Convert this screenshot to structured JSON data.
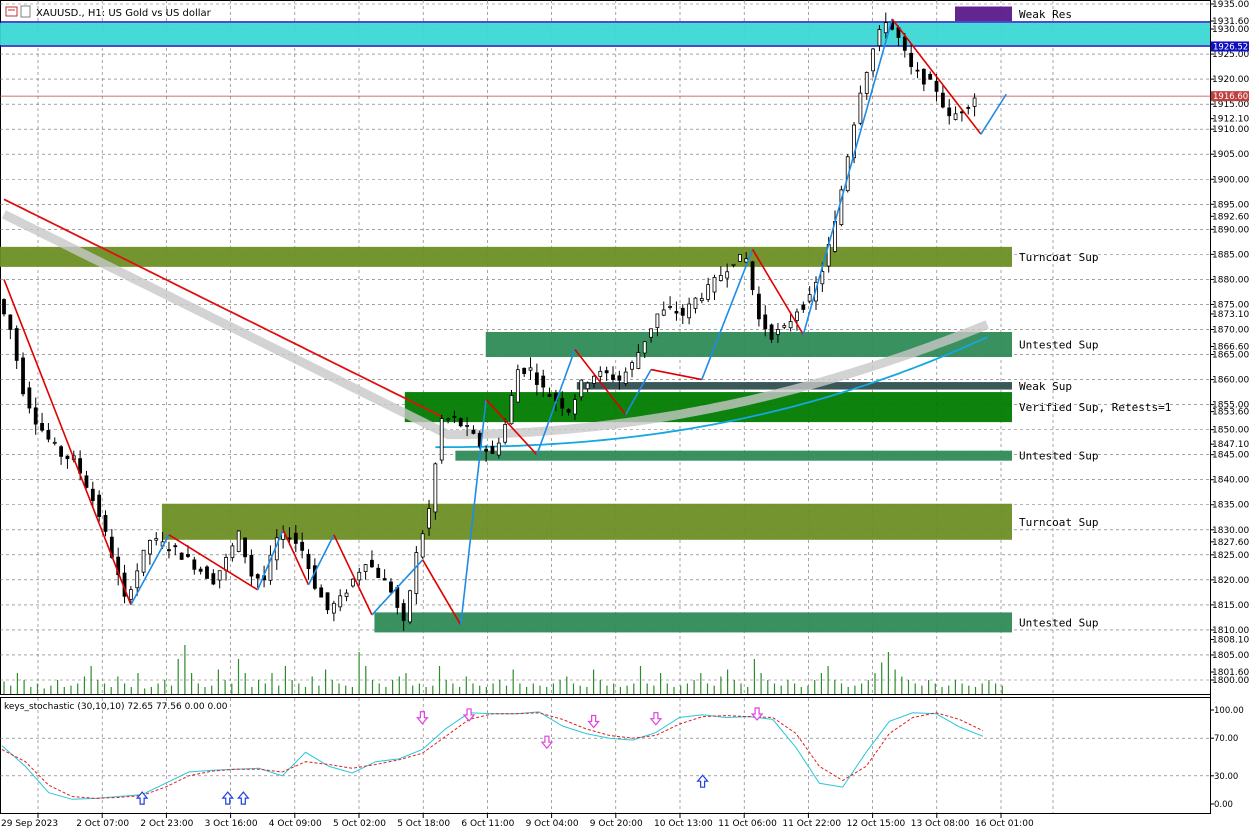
{
  "header": {
    "symbol_title": "XAUUSD., H1:  US Gold vs US dollar"
  },
  "indicator": {
    "title": "keys_stochastic (30,10,10) 72.65 77.56 0.00 0.00"
  },
  "colors": {
    "background": "#ffffff",
    "grid": "#6b6b6b",
    "bull_candle": "#000000",
    "bear_candle": "#000000",
    "zigzag_down": "#e00000",
    "zigzag_up": "#1e8be6",
    "ma_red": "#e01010",
    "ma_band": "#c8c8c8",
    "ma_cyan": "#14a7e0",
    "zone_cyan": "#3cd8d4",
    "zone_olive": "#6b8e23",
    "zone_green": "#2e8b57",
    "zone_dark_green": "#007b00",
    "zone_purple": "#5a1a8a",
    "zone_slate": "#2f4f4f",
    "volume": "#2e8b2e",
    "stoch_main": "#28c8d8",
    "stoch_signal": "#e02020",
    "arrow_down": "#e040e0",
    "arrow_up": "#2040e0",
    "price_line": "#c04040"
  },
  "chart_data": {
    "type": "candlestick",
    "x_tick_labels": [
      "29 Sep 2023",
      "2 Oct 07:00",
      "2 Oct 23:00",
      "3 Oct 16:00",
      "4 Oct 09:00",
      "5 Oct 02:00",
      "5 Oct 18:00",
      "6 Oct 11:00",
      "9 Oct 04:00",
      "9 Oct 20:00",
      "10 Oct 13:00",
      "11 Oct 06:00",
      "11 Oct 22:00",
      "12 Oct 15:00",
      "13 Oct 08:00",
      "16 Oct 01:00"
    ],
    "y_tick_labels": [
      "1935.00",
      "1931.60",
      "1930.00",
      "1925.00",
      "1920.00",
      "1915.00",
      "1912.10",
      "1910.00",
      "1905.00",
      "1900.00",
      "1895.00",
      "1892.60",
      "1890.00",
      "1885.00",
      "1880.00",
      "1875.00",
      "1873.10",
      "1870.00",
      "1866.60",
      "1865.00",
      "1860.00",
      "1855.00",
      "1853.60",
      "1850.00",
      "1847.10",
      "1845.00",
      "1840.00",
      "1835.00",
      "1830.00",
      "1827.60",
      "1825.00",
      "1820.00",
      "1815.00",
      "1810.00",
      "1808.10",
      "1805.00",
      "1801.60",
      "1800.00"
    ],
    "ylim": [
      1800,
      1935
    ],
    "current_price_label": "1916.60",
    "highlight_price_label": "1926.52",
    "close_path": [
      [
        0,
        1876
      ],
      [
        2,
        1870
      ],
      [
        4,
        1858
      ],
      [
        6,
        1852
      ],
      [
        8,
        1848
      ],
      [
        10,
        1845
      ],
      [
        12,
        1844
      ],
      [
        14,
        1839
      ],
      [
        16,
        1833
      ],
      [
        18,
        1825
      ],
      [
        20,
        1816
      ],
      [
        22,
        1822
      ],
      [
        24,
        1828
      ],
      [
        26,
        1827
      ],
      [
        28,
        1826
      ],
      [
        30,
        1824
      ],
      [
        32,
        1822
      ],
      [
        34,
        1820
      ],
      [
        36,
        1824
      ],
      [
        38,
        1829
      ],
      [
        40,
        1821
      ],
      [
        42,
        1820
      ],
      [
        44,
        1828
      ],
      [
        46,
        1829
      ],
      [
        48,
        1826
      ],
      [
        50,
        1819
      ],
      [
        52,
        1814
      ],
      [
        54,
        1816
      ],
      [
        56,
        1820
      ],
      [
        58,
        1824
      ],
      [
        60,
        1821
      ],
      [
        62,
        1818
      ],
      [
        64,
        1811
      ],
      [
        66,
        1825
      ],
      [
        68,
        1834
      ],
      [
        70,
        1852
      ],
      [
        72,
        1852
      ],
      [
        74,
        1850
      ],
      [
        76,
        1847
      ],
      [
        78,
        1845
      ],
      [
        80,
        1851
      ],
      [
        82,
        1862
      ],
      [
        84,
        1862
      ],
      [
        86,
        1858
      ],
      [
        88,
        1856
      ],
      [
        90,
        1854
      ],
      [
        92,
        1859
      ],
      [
        94,
        1861
      ],
      [
        96,
        1861
      ],
      [
        98,
        1860
      ],
      [
        100,
        1863
      ],
      [
        102,
        1868
      ],
      [
        104,
        1873
      ],
      [
        106,
        1874
      ],
      [
        108,
        1873
      ],
      [
        110,
        1876
      ],
      [
        112,
        1878
      ],
      [
        114,
        1881
      ],
      [
        116,
        1884
      ],
      [
        118,
        1884
      ],
      [
        120,
        1872
      ],
      [
        122,
        1869
      ],
      [
        124,
        1870
      ],
      [
        126,
        1874
      ],
      [
        128,
        1876
      ],
      [
        130,
        1882
      ],
      [
        132,
        1891
      ],
      [
        134,
        1905
      ],
      [
        136,
        1918
      ],
      [
        138,
        1926
      ],
      [
        140,
        1932
      ],
      [
        142,
        1928
      ],
      [
        144,
        1922
      ],
      [
        146,
        1920
      ],
      [
        148,
        1918
      ],
      [
        150,
        1912
      ],
      [
        152,
        1914
      ],
      [
        154,
        1916.6
      ]
    ],
    "volume_heights": [
      0.18,
      0.12,
      0.3,
      0.2,
      0.1,
      0.15,
      0.08,
      0.12,
      0.2,
      0.1,
      0.12,
      0.15,
      0.25,
      0.4,
      0.2,
      0.15,
      0.1,
      0.25,
      0.15,
      0.1,
      0.3,
      0.08,
      0.1,
      0.15,
      0.2,
      0.12,
      0.5,
      0.7,
      0.3,
      0.15,
      0.1,
      0.12,
      0.35,
      0.2,
      0.15,
      0.5,
      0.3,
      0.1,
      0.2,
      0.15,
      0.3,
      0.12,
      0.4,
      0.2,
      0.15,
      0.1,
      0.25,
      0.12,
      0.35,
      0.2,
      0.15,
      0.12,
      0.1,
      0.6,
      0.4,
      0.2,
      0.15,
      0.1,
      0.2,
      0.25,
      0.3,
      0.12,
      0.15,
      0.1,
      0.12,
      0.4,
      0.2,
      0.15,
      0.1,
      0.25,
      0.15,
      0.12,
      0.1,
      0.15,
      0.2,
      0.12,
      0.35,
      0.15,
      0.1,
      0.15,
      0.12,
      0.1,
      0.15,
      0.2,
      0.25,
      0.15,
      0.12,
      0.1,
      0.35,
      0.2,
      0.12,
      0.15,
      0.1,
      0.12,
      0.15,
      0.4,
      0.15,
      0.12,
      0.3,
      0.15,
      0.1,
      0.12,
      0.15,
      0.2,
      0.3,
      0.15,
      0.12,
      0.25,
      0.35,
      0.2,
      0.15,
      0.1,
      0.5,
      0.3,
      0.2,
      0.15,
      0.12,
      0.2,
      0.15,
      0.1,
      0.12,
      0.2,
      0.3,
      0.4,
      0.2,
      0.15,
      0.1,
      0.12,
      0.15,
      0.2,
      0.3,
      0.45,
      0.6,
      0.35,
      0.25,
      0.2,
      0.15,
      0.12,
      0.2,
      0.15,
      0.1,
      0.12,
      0.2,
      0.15,
      0.12,
      0.1,
      0.15,
      0.2,
      0.15,
      0.12
    ],
    "stoch_ylim": [
      0,
      100
    ],
    "stoch_tick_labels": [
      "100.00",
      "70.00",
      "30.00",
      "0.00"
    ],
    "stoch_main": [
      [
        0,
        62
      ],
      [
        6,
        40
      ],
      [
        12,
        12
      ],
      [
        18,
        5
      ],
      [
        24,
        6
      ],
      [
        30,
        8
      ],
      [
        36,
        10
      ],
      [
        42,
        22
      ],
      [
        48,
        34
      ],
      [
        54,
        36
      ],
      [
        60,
        37
      ],
      [
        66,
        38
      ],
      [
        72,
        30
      ],
      [
        78,
        55
      ],
      [
        84,
        40
      ],
      [
        90,
        33
      ],
      [
        96,
        45
      ],
      [
        102,
        48
      ],
      [
        108,
        58
      ],
      [
        114,
        80
      ],
      [
        120,
        97
      ],
      [
        126,
        96
      ],
      [
        132,
        96
      ],
      [
        138,
        98
      ],
      [
        144,
        83
      ],
      [
        150,
        75
      ],
      [
        156,
        70
      ],
      [
        162,
        68
      ],
      [
        168,
        76
      ],
      [
        174,
        92
      ],
      [
        180,
        95
      ],
      [
        186,
        92
      ],
      [
        192,
        93
      ],
      [
        198,
        90
      ],
      [
        204,
        60
      ],
      [
        210,
        22
      ],
      [
        216,
        18
      ],
      [
        222,
        55
      ],
      [
        228,
        88
      ],
      [
        234,
        97
      ],
      [
        240,
        96
      ],
      [
        246,
        82
      ],
      [
        252,
        72
      ]
    ],
    "stoch_signal": [
      [
        0,
        58
      ],
      [
        6,
        45
      ],
      [
        12,
        20
      ],
      [
        18,
        8
      ],
      [
        24,
        6
      ],
      [
        30,
        7
      ],
      [
        36,
        9
      ],
      [
        42,
        18
      ],
      [
        48,
        30
      ],
      [
        54,
        35
      ],
      [
        60,
        37
      ],
      [
        66,
        37
      ],
      [
        72,
        34
      ],
      [
        78,
        45
      ],
      [
        84,
        42
      ],
      [
        90,
        38
      ],
      [
        96,
        42
      ],
      [
        102,
        47
      ],
      [
        108,
        54
      ],
      [
        114,
        72
      ],
      [
        120,
        90
      ],
      [
        126,
        96
      ],
      [
        132,
        96
      ],
      [
        138,
        97
      ],
      [
        144,
        90
      ],
      [
        150,
        80
      ],
      [
        156,
        73
      ],
      [
        162,
        70
      ],
      [
        168,
        73
      ],
      [
        174,
        85
      ],
      [
        180,
        93
      ],
      [
        186,
        94
      ],
      [
        192,
        93
      ],
      [
        198,
        92
      ],
      [
        204,
        75
      ],
      [
        210,
        40
      ],
      [
        216,
        25
      ],
      [
        222,
        40
      ],
      [
        228,
        75
      ],
      [
        234,
        92
      ],
      [
        240,
        97
      ],
      [
        246,
        90
      ],
      [
        252,
        78
      ]
    ],
    "stoch_arrows": [
      {
        "dir": "up",
        "at": 36,
        "level": 2
      },
      {
        "dir": "up",
        "at": 58,
        "level": 2
      },
      {
        "dir": "up",
        "at": 62,
        "level": 2
      },
      {
        "dir": "down",
        "at": 108,
        "level": 96
      },
      {
        "dir": "down",
        "at": 120,
        "level": 99
      },
      {
        "dir": "down",
        "at": 140,
        "level": 70
      },
      {
        "dir": "down",
        "at": 152,
        "level": 92
      },
      {
        "dir": "down",
        "at": 168,
        "level": 95
      },
      {
        "dir": "up",
        "at": 180,
        "level": 20
      },
      {
        "dir": "down",
        "at": 194,
        "level": 100
      }
    ],
    "zones": [
      {
        "label": "Weak Res",
        "top": 1934.5,
        "bottom": 1931.6,
        "x_start": 0.76,
        "color": "zone_purple"
      },
      {
        "label": "",
        "top": 1931.2,
        "bottom": 1926.8,
        "x_start": 0.0,
        "color": "zone_cyan"
      },
      {
        "label": "Turncoat Sup",
        "top": 1886.5,
        "bottom": 1882.5,
        "x_start": 0.0,
        "color": "zone_olive"
      },
      {
        "label": "Untested Sup",
        "top": 1869.5,
        "bottom": 1864.5,
        "x_start": 0.48,
        "color": "zone_green"
      },
      {
        "label": "Weak Sup",
        "top": 1859.5,
        "bottom": 1858.0,
        "x_start": 0.57,
        "color": "zone_slate"
      },
      {
        "label": "Verified Sup, Retests=1",
        "top": 1857.5,
        "bottom": 1851.5,
        "x_start": 0.4,
        "color": "zone_dark_green"
      },
      {
        "label": "Untested Sup",
        "top": 1845.8,
        "bottom": 1843.8,
        "x_start": 0.45,
        "color": "zone_green"
      },
      {
        "label": "Turncoat Sup",
        "top": 1835.2,
        "bottom": 1828.0,
        "x_start": 0.16,
        "color": "zone_olive"
      },
      {
        "label": "Untested Sup",
        "top": 1813.5,
        "bottom": 1809.5,
        "x_start": 0.37,
        "color": "zone_green"
      }
    ]
  }
}
